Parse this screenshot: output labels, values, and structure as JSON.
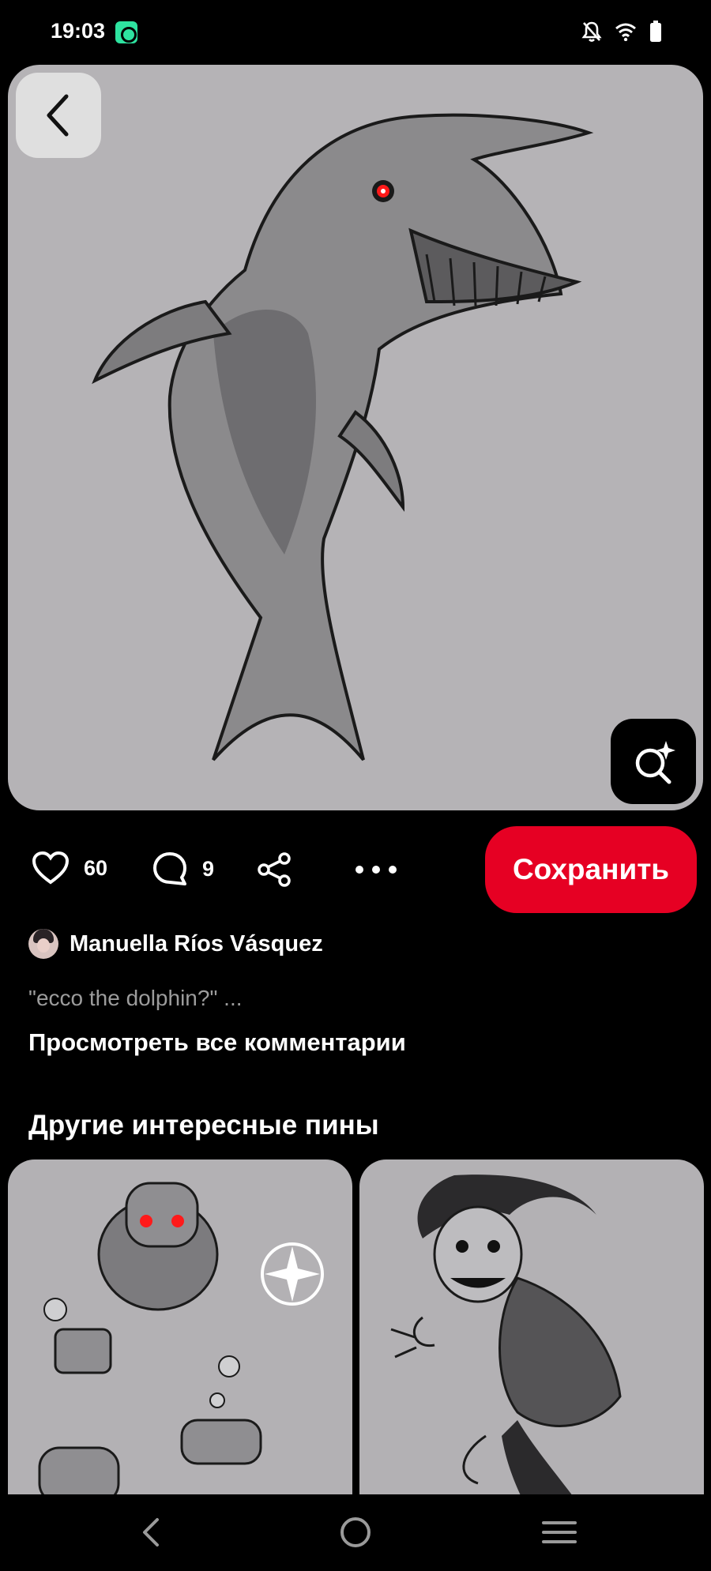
{
  "status_bar": {
    "time": "19:03",
    "icons": [
      "music-app-icon",
      "bell-off-icon",
      "wifi-icon",
      "battery-icon"
    ]
  },
  "pin": {
    "back_icon": "chevron-left-icon",
    "visual_search_icon": "lens-sparkle-icon",
    "likes": "60",
    "comments": "9",
    "save_label": "Сохранить",
    "save_color": "#e60023"
  },
  "author": {
    "name": "Manuella Ríos Vásquez"
  },
  "comments": {
    "preview": "\"ecco the dolphin?\" ...",
    "view_all_label": "Просмотреть все комментарии"
  },
  "more_pins": {
    "title": "Другие интересные пины"
  },
  "nav": {
    "items": [
      "back-nav-icon",
      "home-nav-icon",
      "recents-nav-icon"
    ]
  }
}
